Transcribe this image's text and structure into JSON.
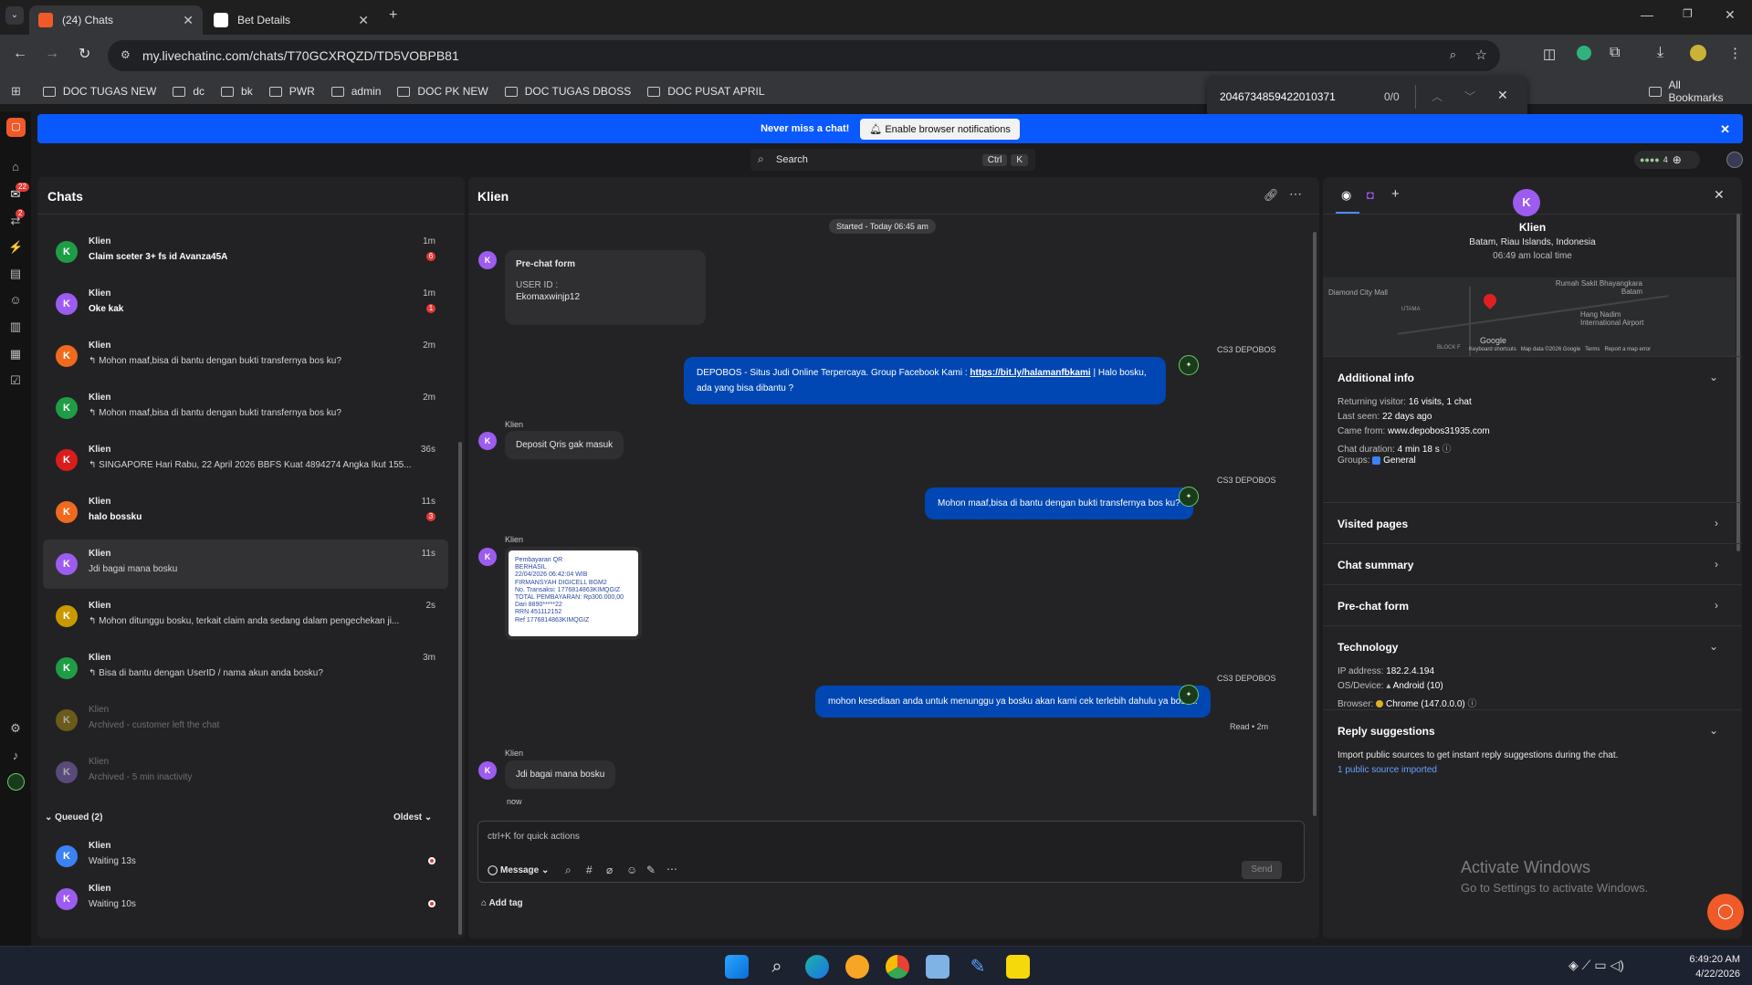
{
  "browser": {
    "tabs": [
      {
        "label": "(24) Chats"
      },
      {
        "label": "Bet Details"
      }
    ],
    "url": "my.livechatinc.com/chats/T70GCXRQZD/TD5VOBPB81",
    "bookmarks": [
      "DOC TUGAS NEW",
      "dc",
      "bk",
      "PWR",
      "admin",
      "DOC PK NEW",
      "DOC TUGAS DBOSS",
      "DOC PUSAT APRIL"
    ],
    "all_bookmarks": "All Bookmarks",
    "find_bar": {
      "query": "2046734859422010371",
      "count": "0/0"
    }
  },
  "leftnav": {
    "chats_badge": "22",
    "tickets_badge": "2"
  },
  "banner": {
    "text": "Never miss a chat!",
    "button": "Enable browser notifications"
  },
  "search": {
    "placeholder": "Search",
    "key1": "Ctrl",
    "key2": "K"
  },
  "header_widget": {
    "count": "4"
  },
  "chats_panel": {
    "title": "Chats",
    "items": [
      {
        "initial": "K",
        "name": "Klien",
        "message": "Claim sceter 3+ fs id Avanza45A",
        "time": "1m",
        "badge": "6",
        "color": "#1f9d46",
        "bold": true
      },
      {
        "initial": "K",
        "name": "Klien",
        "message": "Oke kak",
        "time": "1m",
        "badge": "1",
        "color": "#9d5cf0",
        "bold": true
      },
      {
        "initial": "K",
        "name": "Klien",
        "message": "↰ Mohon maaf,bisa di bantu dengan bukti transfernya bos ku?",
        "time": "2m",
        "badge": "",
        "color": "#f06a1d",
        "bold": false
      },
      {
        "initial": "K",
        "name": "Klien",
        "message": "↰ Mohon maaf,bisa di bantu dengan bukti transfernya bos ku?",
        "time": "2m",
        "badge": "",
        "color": "#1f9d46",
        "bold": false
      },
      {
        "initial": "K",
        "name": "Klien",
        "message": "↰ SINGAPORE Hari Rabu, 22 April 2026 BBFS Kuat 4894274 Angka Ikut 155...",
        "time": "36s",
        "badge": "",
        "color": "#d91c1c",
        "bold": false
      },
      {
        "initial": "K",
        "name": "Klien",
        "message": "halo bossku",
        "time": "11s",
        "badge": "3",
        "color": "#f06a1d",
        "bold": true
      },
      {
        "initial": "K",
        "name": "Klien",
        "message": "Jdi bagai mana bosku",
        "time": "11s",
        "badge": "",
        "color": "#9d5cf0",
        "bold": false
      },
      {
        "initial": "K",
        "name": "Klien",
        "message": "↰ Mohon ditunggu bosku, terkait claim anda sedang dalam pengechekan ji...",
        "time": "2s",
        "badge": "",
        "color": "#c99a00",
        "bold": false
      },
      {
        "initial": "K",
        "name": "Klien",
        "message": "↰ Bisa di bantu dengan UserID / nama akun anda bosku?",
        "time": "3m",
        "badge": "",
        "color": "#1f9d46",
        "bold": false
      },
      {
        "initial": "K",
        "name": "Klien",
        "message": "Archived - customer left the chat",
        "time": "",
        "badge": "",
        "color": "#6b5a1a",
        "bold": false
      },
      {
        "initial": "K",
        "name": "Klien",
        "message": "Archived - 5 min inactivity",
        "time": "",
        "badge": "",
        "color": "#5a4a7a",
        "bold": false
      }
    ],
    "queued_label": "Queued (2)",
    "sort_label": "Oldest",
    "queued": [
      {
        "initial": "K",
        "name": "Klien",
        "message": "Waiting 13s",
        "color": "#3b82f6"
      },
      {
        "initial": "K",
        "name": "Klien",
        "message": "Waiting 10s",
        "color": "#9d5cf0"
      }
    ]
  },
  "conversation": {
    "title": "Klien",
    "started": "Started - Today 06:45 am",
    "prechat": {
      "title": "Pre-chat form",
      "field": "USER ID :",
      "value": "Ekomaxwinjp12"
    },
    "agent_name": "CS3 DEPOBOS",
    "msg1_pre": "DEPOBOS - Situs Judi Online Terpercaya. Group Facebook Kami :",
    "msg1_link": "https://bit.ly/halamanfbkami",
    "msg1_post": "| Halo bosku, ada yang bisa dibantu ?",
    "client_label": "Klien",
    "client_msg1": "Deposit Qris gak masuk",
    "agent_msg2": "Mohon maaf,bisa di bantu dengan bukti transfernya bos ku?",
    "receipt_lines": [
      "Pembayaran QR",
      "BERHASIL",
      "22/04/2026 06:42:04 WIB",
      "FIRMANSYAH DIGICELL BGM2",
      "No. Transaksi: 1776814863KIMQGIZ",
      "TOTAL PEMBAYARAN: Rp300.000,00",
      "Dari 8890*****22",
      "RRN 451112152",
      "Ref 1776814863KIMQGIZ"
    ],
    "agent_msg3": "mohon kesediaan anda untuk menunggu ya bosku akan kami cek terlebih dahulu ya bosku.",
    "read_status": "Read • 2m",
    "client_msg2": "Jdi bagai mana bosku",
    "client_msg2_time": "now",
    "composer_placeholder": "ctrl+K for quick actions",
    "message_mode": "Message",
    "send": "Send",
    "add_tag": "Add tag"
  },
  "details": {
    "initial": "K",
    "name": "Klien",
    "location": "Batam, Riau Islands, Indonesia",
    "local_time": "06:49 am local time",
    "map_labels": [
      "Diamond City Mall",
      "Rumah Sakit Bhayangkara Batam",
      "UTAMA",
      "Hang Nadim International Airport",
      "BLOCK F",
      "Google",
      "Keyboard shortcuts",
      "Map data ©2026 Google",
      "Terms",
      "Report a map error"
    ],
    "additional_info": "Additional info",
    "returning_label": "Returning visitor:",
    "returning_value": "16 visits, 1 chat",
    "last_seen_label": "Last seen:",
    "last_seen_value": "22 days ago",
    "came_from_label": "Came from:",
    "came_from_value": "www.depobos31935.com",
    "duration_label": "Chat duration:",
    "duration_value": "4 min 18 s",
    "groups_label": "Groups:",
    "groups_value": "General",
    "visited_pages": "Visited pages",
    "chat_summary": "Chat summary",
    "prechat_form": "Pre-chat form",
    "technology": "Technology",
    "ip_label": "IP address:",
    "ip_value": "182.2.4.194",
    "os_label": "OS/Device:",
    "os_value": "Android (10)",
    "browser_label": "Browser:",
    "browser_value": "Chrome (147.0.0.0)",
    "reply_suggestions": "Reply suggestions",
    "reply_desc": "Import public sources to get instant reply suggestions during the chat.",
    "reply_more": "1 public source imported"
  },
  "watermark": {
    "line1": "Activate Windows",
    "line2": "Go to Settings to activate Windows."
  },
  "taskbar": {
    "time": "6:49:20 AM",
    "date": "4/22/2026"
  }
}
